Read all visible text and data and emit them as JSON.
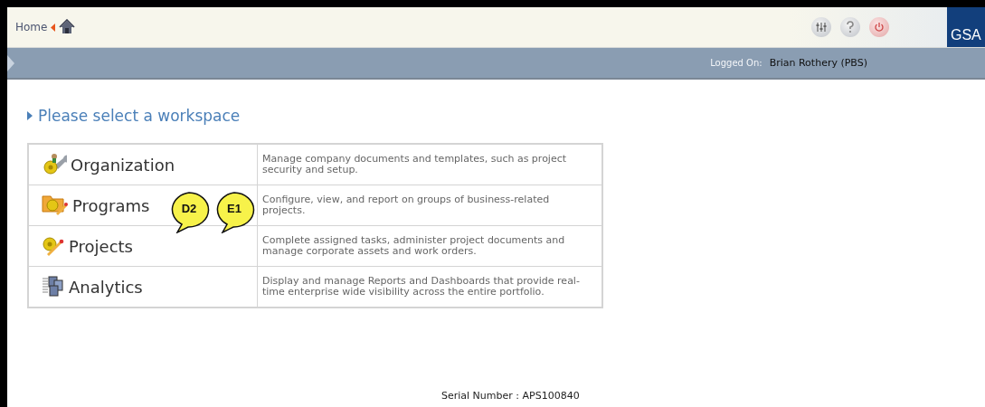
{
  "header": {
    "breadcrumb": "Home",
    "logo": "GSA"
  },
  "status_bar": {
    "label": "Logged On:",
    "user": "Brian Rothery (PBS)"
  },
  "heading": "Please select a workspace",
  "workspaces": [
    {
      "name": "Organization",
      "description": "Manage company documents and templates, such as project security and setup."
    },
    {
      "name": "Programs",
      "description": "Configure, view, and report on groups of business-related projects."
    },
    {
      "name": "Projects",
      "description": "Complete assigned tasks, administer project documents and manage corporate assets and work orders."
    },
    {
      "name": "Analytics",
      "description": "Display and manage Reports and Dashboards that provide real-time enterprise wide visibility across the entire portfolio."
    }
  ],
  "callouts": [
    {
      "label": "D2"
    },
    {
      "label": "E1"
    }
  ],
  "footer": {
    "serial": "Serial Number : APS100840"
  }
}
